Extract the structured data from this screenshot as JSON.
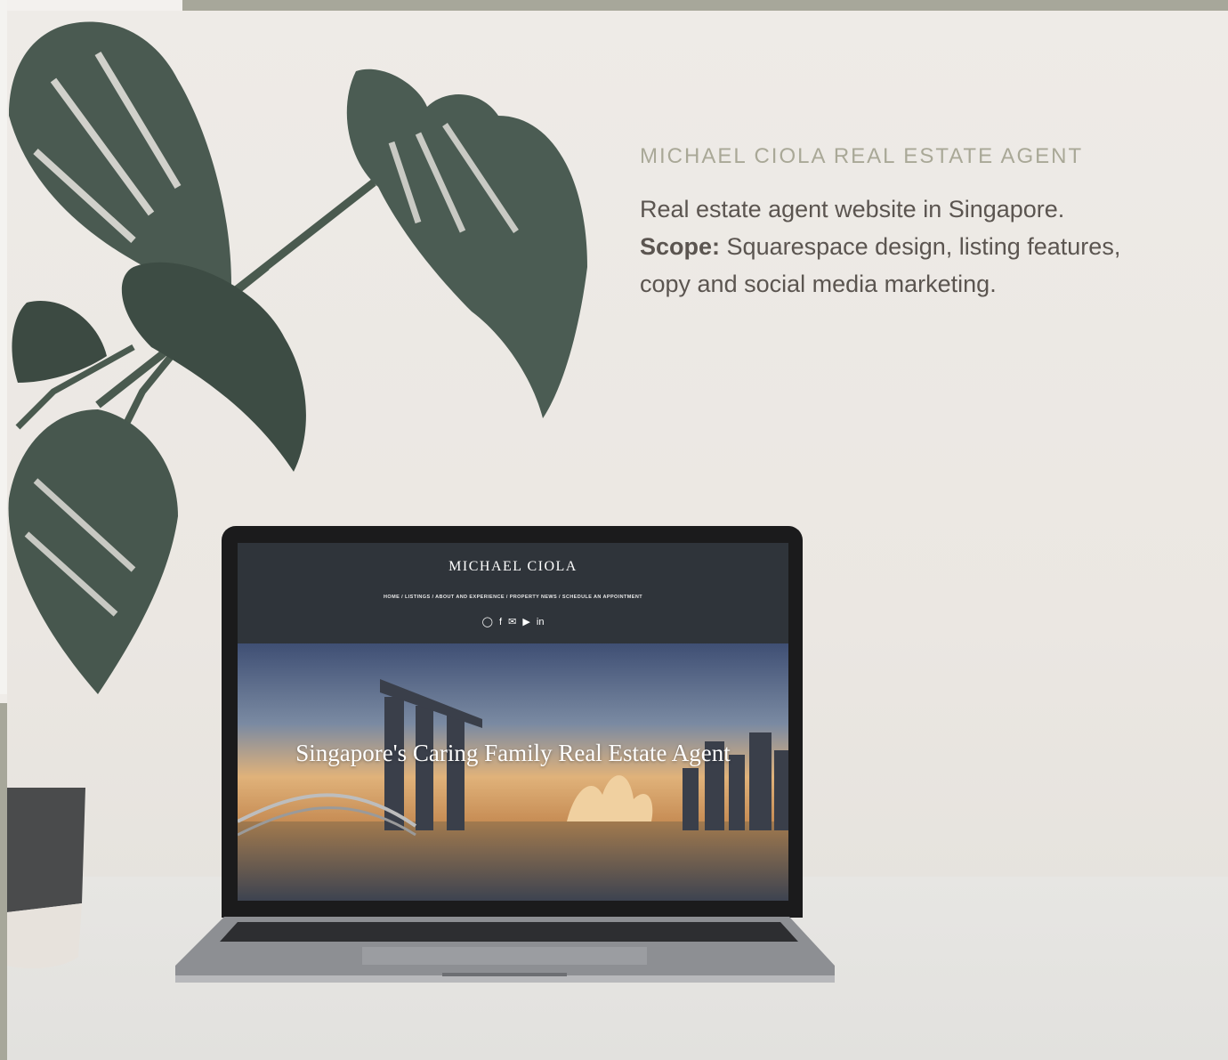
{
  "info": {
    "title": "MICHAEL CIOLA REAL ESTATE AGENT",
    "line1": "Real estate agent website in Singapore.",
    "scope_label": "Scope:",
    "scope_text": "Squarespace design, listing features,",
    "line3": "copy and social media marketing."
  },
  "website": {
    "title": "MICHAEL CIOLA",
    "nav": [
      "HOME",
      "LISTINGS",
      "ABOUT AND EXPERIENCE",
      "PROPERTY NEWS",
      "SCHEDULE AN APPOINTMENT"
    ],
    "nav_separator": " / ",
    "social_icons": [
      "instagram-icon",
      "facebook-icon",
      "mail-icon",
      "youtube-icon",
      "linkedin-icon"
    ],
    "hero_headline": "Singapore's Caring Family Real Estate Agent"
  },
  "colors": {
    "accent_title": "#a9a897",
    "body_text": "#5b5550",
    "top_bar": "#a7a79a",
    "site_header": "#2f343a"
  }
}
